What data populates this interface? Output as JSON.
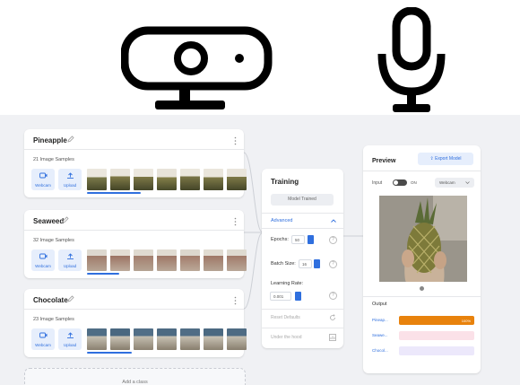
{
  "icons": {
    "top_left": "webcam-icon",
    "top_right": "microphone-icon"
  },
  "colors": {
    "accent": "#2f6fde",
    "output_bar": "#e8820c",
    "bar2": "#fbe1e8",
    "bar3": "#ece8fb"
  },
  "classes": [
    {
      "name": "Pineapple",
      "samples": "21 Image Samples",
      "webcam": "Webcam",
      "upload": "Upload"
    },
    {
      "name": "Seaweed",
      "samples": "32 Image Samples",
      "webcam": "Webcam",
      "upload": "Upload"
    },
    {
      "name": "Chocolate",
      "samples": "23 Image Samples",
      "webcam": "Webcam",
      "upload": "Upload"
    }
  ],
  "add_class": "Add a class",
  "training": {
    "title": "Training",
    "model_button": "Model Trained",
    "advanced": "Advanced",
    "epochs_label": "Epochs:",
    "epochs_value": "50",
    "batch_label": "Batch Size:",
    "batch_value": "16",
    "lr_label": "Learning Rate:",
    "lr_value": "0.001",
    "reset": "Reset Defaults",
    "under_hood": "Under the hood"
  },
  "preview": {
    "title": "Preview",
    "export": "Export Model",
    "input_label": "Input",
    "input_state": "ON",
    "source": "Webcam",
    "output_label": "Output",
    "bars": [
      {
        "label": "Pineap...",
        "value": 1.0,
        "display": "100%"
      },
      {
        "label": "Seawe...",
        "value": 0.0
      },
      {
        "label": "Chocol...",
        "value": 0.0
      }
    ]
  }
}
